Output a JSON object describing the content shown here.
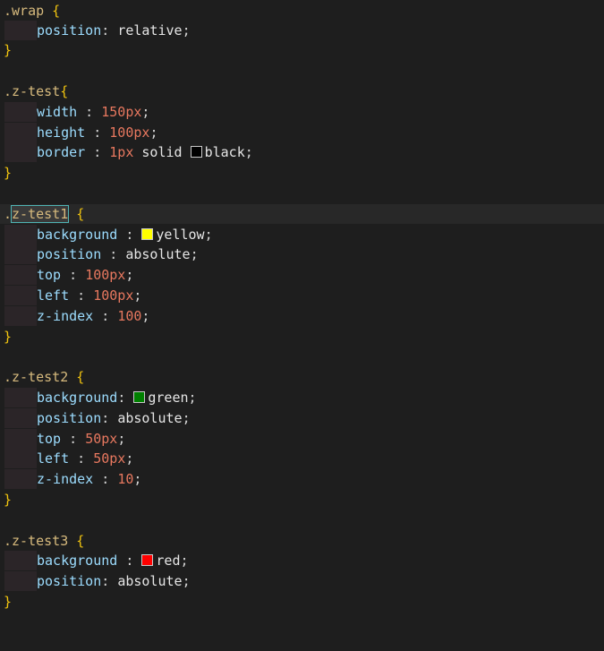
{
  "editor": {
    "language": "CSS",
    "highlighted_line": 11,
    "lines": [
      {
        "t": ".wrap {"
      },
      {
        "t": "position: relative;"
      },
      {
        "t": "}"
      },
      {
        "t": ""
      },
      {
        "t": ".z-test{"
      },
      {
        "t": "width : 150px;"
      },
      {
        "t": "height : 100px;"
      },
      {
        "t": "border : 1px solid black;"
      },
      {
        "t": "}"
      },
      {
        "t": ""
      },
      {
        "t": ".z-test1 {"
      },
      {
        "t": "background : yellow;"
      },
      {
        "t": "position : absolute;"
      },
      {
        "t": "top : 100px;"
      },
      {
        "t": "left : 100px;"
      },
      {
        "t": "z-index : 100;"
      },
      {
        "t": "}"
      },
      {
        "t": ""
      },
      {
        "t": ".z-test2 {"
      },
      {
        "t": "background: green;"
      },
      {
        "t": "position: absolute;"
      },
      {
        "t": "top : 50px;"
      },
      {
        "t": "left : 50px;"
      },
      {
        "t": "z-index : 10;"
      },
      {
        "t": "}"
      },
      {
        "t": ""
      },
      {
        "t": ".z-test3 {"
      },
      {
        "t": "background : red;"
      },
      {
        "t": "position: absolute;"
      },
      {
        "t": "}"
      }
    ]
  },
  "swatches": {
    "black": "#000000",
    "yellow": "#ffff00",
    "green": "#008000",
    "red": "#ff0000"
  },
  "text": {
    "wrap_sel": ".wrap",
    "brace_open": " {",
    "brace_open_tight": "{",
    "brace_close": "}",
    "position": "position",
    "relative": "relative",
    "absolute": "absolute",
    "ztest_sel": ".z-test",
    "width": "width",
    "height": "height",
    "border": "border",
    "v150px": "150px",
    "v100px": "100px",
    "v1px": "1px",
    "solid": "solid",
    "black": "black",
    "dot": ".",
    "ztest1_name": "z-test1",
    "background": "background",
    "yellow": "yellow",
    "top": "top",
    "left": "left",
    "zindex": "z-index",
    "v100": "100",
    "ztest2_sel": ".z-test2",
    "green": "green",
    "v50px": "50px",
    "v10": "10",
    "ztest3_sel": ".z-test3",
    "red": "red",
    "sep_spaced": " : ",
    "sep_tight": ": ",
    "semi": ";"
  }
}
